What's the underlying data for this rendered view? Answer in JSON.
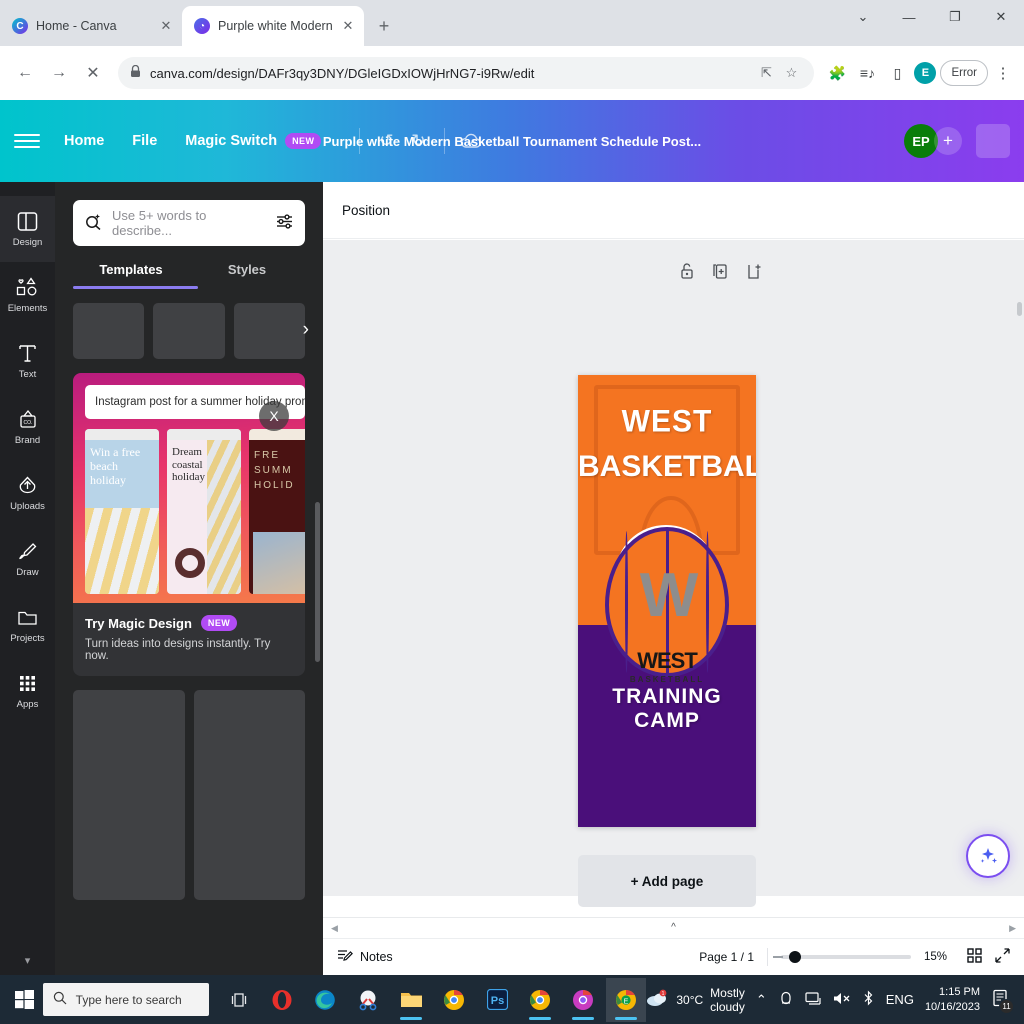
{
  "browser": {
    "tabs": [
      {
        "title": "Home - Canva",
        "favicon": "canva-icon",
        "active": false,
        "close": "✕"
      },
      {
        "title": "Purple white Modern Basketball",
        "favicon": "canva-doc-icon",
        "active": true,
        "close": "✕"
      }
    ],
    "new_tab_label": "+",
    "window_controls": {
      "expand": "⌄",
      "minimize": "—",
      "maximize": "❐",
      "close": "✕"
    },
    "nav": {
      "back": "←",
      "forward": "→",
      "reload": "✕"
    },
    "url": "canva.com/design/DAFr3qy3DNY/DGleIGDxIOWjHrNG7-i9Rw/edit",
    "lock_icon": "🔒",
    "omnibox_actions": [
      "share-icon",
      "bookmark-star-icon"
    ],
    "toolbar_icons": [
      "extensions-puzzle-icon",
      "reading-list-icon",
      "sidepanel-icon"
    ],
    "profile_initial": "E",
    "error_label": "Error",
    "menu_icon": "⋮"
  },
  "canva_header": {
    "menu_icon": "hamburger-icon",
    "items": [
      {
        "label": "Home",
        "badge": ""
      },
      {
        "label": "File",
        "badge": ""
      },
      {
        "label": "Magic Switch",
        "badge": "NEW"
      }
    ],
    "undo_icon": "↺",
    "redo_icon": "↻",
    "cloud_icon": "saved-cloud-icon",
    "doc_title": "Purple white Modern Basketball Tournament Schedule Post...",
    "avatar_initials": "EP",
    "add_collaborator": "+",
    "accent_start": "#00c4cc",
    "accent_end": "#8b3dee"
  },
  "rail": {
    "items": [
      {
        "label": "Design",
        "icon": "design-layout-icon",
        "active": true
      },
      {
        "label": "Elements",
        "icon": "shapes-icon",
        "active": false
      },
      {
        "label": "Text",
        "icon": "text-t-icon",
        "active": false
      },
      {
        "label": "Brand",
        "icon": "brand-kit-icon",
        "active": false
      },
      {
        "label": "Uploads",
        "icon": "upload-cloud-icon",
        "active": false
      },
      {
        "label": "Draw",
        "icon": "pen-icon",
        "active": false
      },
      {
        "label": "Projects",
        "icon": "folder-icon",
        "active": false
      },
      {
        "label": "Apps",
        "icon": "grid-dots-icon",
        "active": false
      }
    ],
    "scroll_down": "▾"
  },
  "panel": {
    "search_placeholder": "Use 5+ words to describe...",
    "search_icon": "magic-search-icon",
    "filter_icon": "filters-sliders-icon",
    "tabs": [
      {
        "label": "Templates",
        "active": true
      },
      {
        "label": "Styles",
        "active": false
      }
    ],
    "carousel_next": "›",
    "promo": {
      "prompt": "Instagram post for a summer holiday promo",
      "close": "X",
      "title": "Try Magic Design",
      "badge": "NEW",
      "subtitle": "Turn ideas into designs instantly. Try now.",
      "cards": [
        {
          "text": "Win a free beach holiday"
        },
        {
          "text": "Dream coastal holiday"
        },
        {
          "text": "FRE SUMM HOLID"
        }
      ]
    },
    "collapse_icon": "‹"
  },
  "editor": {
    "position_label": "Position",
    "float_tools": [
      {
        "icon": "unlock-icon"
      },
      {
        "icon": "duplicate-page-icon"
      },
      {
        "icon": "add-page-after-icon"
      }
    ],
    "poster": {
      "line1": "WEST",
      "line2": "BASKETBALL",
      "line3": "TRAINING CAMP",
      "logo_letter": "W",
      "logo_word": "WEST",
      "logo_sub": "BASKETBALL",
      "orange": "#f47421",
      "purple": "#4a0f7a",
      "ball_outline": "#4a1f8c"
    },
    "add_page_label": "+ Add page",
    "bottom": {
      "notes_label": "Notes",
      "notes_icon": "notes-icon",
      "page_count": "Page 1 / 1",
      "zoom_value": "15%",
      "grid_icon": "grid-view-icon",
      "fullscreen_icon": "fullscreen-icon"
    },
    "ai_fab_icon": "magic-sparkle-icon",
    "scroll_up_icon": "^"
  },
  "taskbar": {
    "start_icon": "windows-logo-icon",
    "search_placeholder": "Type here to search",
    "search_icon": "search-icon",
    "apps": [
      {
        "icon": "task-view-icon",
        "name": "task-view",
        "running": false,
        "active": false
      },
      {
        "icon": "opera-icon",
        "name": "opera",
        "running": false,
        "active": false
      },
      {
        "icon": "edge-icon",
        "name": "microsoft-edge",
        "running": false,
        "active": false
      },
      {
        "icon": "snipping-tool-icon",
        "name": "snipping-tool",
        "running": false,
        "active": false
      },
      {
        "icon": "file-explorer-icon",
        "name": "file-explorer",
        "running": true,
        "active": false
      },
      {
        "icon": "chrome-icon",
        "name": "google-chrome",
        "running": false,
        "active": false
      },
      {
        "icon": "photoshop-icon",
        "name": "photoshop",
        "running": false,
        "active": false
      },
      {
        "icon": "chrome-profile-icon",
        "name": "chrome-profile-1",
        "running": true,
        "active": false
      },
      {
        "icon": "chrome-profile2-icon",
        "name": "chrome-profile-2",
        "running": true,
        "active": false
      },
      {
        "icon": "chrome-active-icon",
        "name": "chrome-active",
        "running": true,
        "active": true
      }
    ],
    "tray": {
      "temperature": "30°C",
      "weather": "Mostly cloudy",
      "chevron": "⌃",
      "icons": [
        "onedrive-icon",
        "network-icon",
        "volume-mute-icon",
        "bluetooth-icon"
      ],
      "language": "ENG",
      "time": "1:15 PM",
      "date": "10/16/2023",
      "notification_count": "11"
    }
  }
}
